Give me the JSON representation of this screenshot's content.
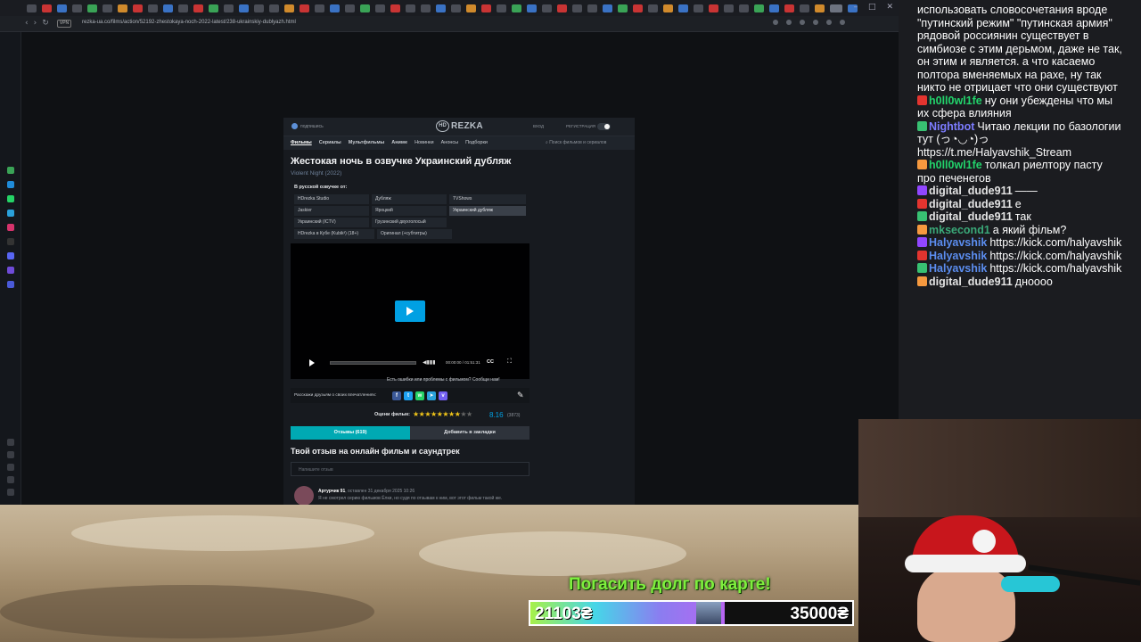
{
  "browser": {
    "url": "rezka-ua.co/films/action/52192-zhestokaya-noch-2022-latest/238-ukrainskiy-dublyazh.html",
    "vpn_label": "VPN"
  },
  "site": {
    "header": {
      "login": "подпишись",
      "logo_badge": "HD",
      "logo_word": "REZKA",
      "enter": "ВХОД",
      "register": "РЕГИСТРАЦИЯ"
    },
    "nav": {
      "items": [
        "Фильмы",
        "Сериалы",
        "Мультфильмы",
        "Аниме",
        "Новинки",
        "Анонсы",
        "Подборки"
      ],
      "search_placeholder": "Поиск фильмов и сериалов"
    },
    "film": {
      "title": "Жестокая ночь в озвучке Украинский дубляж",
      "original": "Violent Night (2022)",
      "dub_label": "В русской озвучке от:",
      "dubs": [
        {
          "label": "HDrezka Studio",
          "selected": false
        },
        {
          "label": "Дубляж",
          "selected": false
        },
        {
          "label": "TVShows",
          "selected": false
        },
        {
          "label": "Jaskier",
          "selected": false
        },
        {
          "label": "Яроцкий",
          "selected": false
        },
        {
          "label": "Украинский дубляж",
          "selected": true
        },
        {
          "label": "Украинский (ICTV)",
          "selected": false
        },
        {
          "label": "Грузинский двухголосый",
          "selected": false
        },
        {
          "label": "HDrezka в Кубе (Kubik³) (18+)",
          "selected": false
        },
        {
          "label": "Оригинал (+субтитры)",
          "selected": false
        }
      ]
    },
    "player": {
      "timecode": "00:00:00 / 01:51:31",
      "cc": "CC",
      "report": "Есть ошибки или проблемы с фильмом? Сообщи нам!"
    },
    "share": {
      "text": "Расскажи друзьям о своих впечатлениях:"
    },
    "rating": {
      "label": "Оцени фильм:",
      "value": "8.16",
      "count": "(3873)",
      "stars_filled": 8,
      "stars_total": 10
    },
    "tabs": {
      "reviews": "Отзывы (619)",
      "bookmark": "Добавить в закладки"
    },
    "review": {
      "heading": "Твой отзыв на онлайн фильм и саундтрек",
      "placeholder": "Напишите отзыв",
      "author": "Артурчик 91",
      "meta": ", оставлен 31 декабря 2025 10:26",
      "snippet": "Я не смотрел серию фильмов Ёлки, но судя по отзывам к ним, вот этот фильм такой же."
    }
  },
  "chat": {
    "messages": [
      {
        "user": "",
        "color": "#ffffff",
        "text": "использовать словосочетания вроде \"путинский режим\" \"путинская армия\" рядовой россиянин существует в симбиозе с этим дерьмом, даже не так, он этим и является. а что касаемо полтора вменяемых на рахе, ну так никто не отрицает что они существуют"
      },
      {
        "user": "h0ll0wl1fe",
        "color": "#22d36b",
        "text": "ну они убеждены что мы их сфера влияния"
      },
      {
        "user": "Nightbot",
        "color": "#7c7cff",
        "text": "Читаю лекции по базологии тут (っ◔◡◔)っ https://t.me/Halyavshik_Stream"
      },
      {
        "user": "h0ll0wl1fe",
        "color": "#22d36b",
        "text": "толкал риелтору пасту про печенегов"
      },
      {
        "user": "digital_dude911",
        "color": "#e4e4e4",
        "text": "——"
      },
      {
        "user": "digital_dude911",
        "color": "#e4e4e4",
        "text": "е"
      },
      {
        "user": "digital_dude911",
        "color": "#e4e4e4",
        "text": "так"
      },
      {
        "user": "mksecond1",
        "color": "#3aa878",
        "text": "а який фільм?"
      },
      {
        "user": "Halyavshik",
        "color": "#5b8def",
        "text": "https://kick.com/halyavshik"
      },
      {
        "user": "Halyavshik",
        "color": "#5b8def",
        "text": "https://kick.com/halyavshik"
      },
      {
        "user": "Halyavshik",
        "color": "#5b8def",
        "text": "https://kick.com/halyavshik"
      },
      {
        "user": "digital_dude911",
        "color": "#e4e4e4",
        "text": "дноооо"
      }
    ]
  },
  "donation": {
    "title": "Погасить долг по карте!",
    "current": "21103₴",
    "goal": "35000₴",
    "progress_fraction": 0.603
  }
}
